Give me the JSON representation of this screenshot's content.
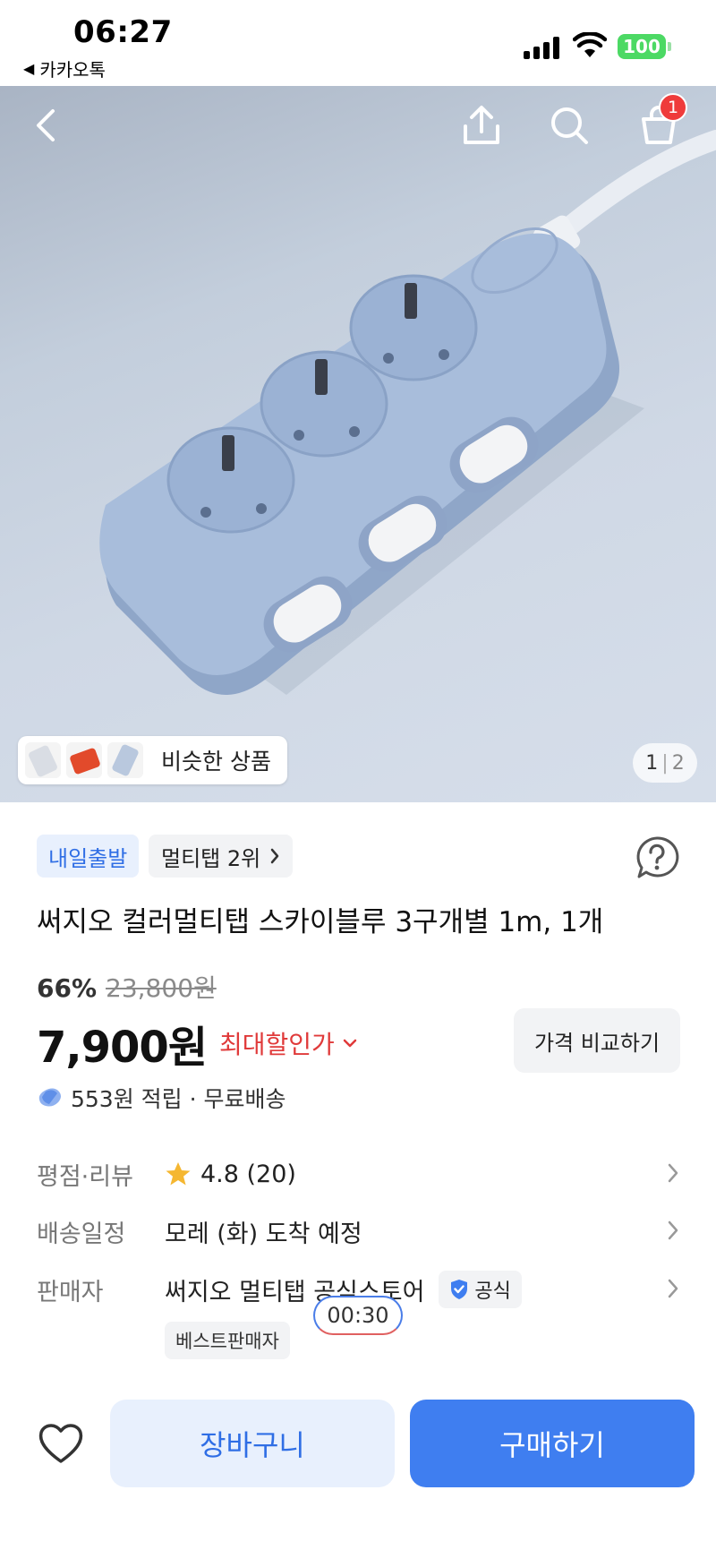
{
  "status_bar": {
    "time": "06:27",
    "back_app": "카카오톡",
    "battery": "100"
  },
  "hero": {
    "cart_count": "1",
    "similar_label": "비슷한 상품",
    "pager_current": "1",
    "pager_separator": "|",
    "pager_total": "2"
  },
  "product": {
    "tag_delivery": "내일출발",
    "tag_rank": "멀티탭 2위",
    "title": "써지오 컬러멀티탭 스카이블루 3구개별 1m, 1개",
    "discount_pct": "66%",
    "original_price": "23,800원",
    "price": "7,900원",
    "max_discount": "최대할인가",
    "compare_label": "가격 비교하기",
    "points": "553원 적립 · 무료배송"
  },
  "info": {
    "rating_label": "평점·리뷰",
    "rating_value": "4.8 (20)",
    "shipping_label": "배송일정",
    "shipping_value": "모레 (화) 도착 예정",
    "seller_label": "판매자",
    "seller_value": "써지오 멀티탭 공식스토어",
    "official_badge": "공식",
    "best_seller": "베스트판매자",
    "timer": "00:30"
  },
  "bottom_bar": {
    "cart_button": "장바구니",
    "buy_button": "구매하기"
  },
  "colors": {
    "accent_blue": "#3f7ef0",
    "discount_red": "#e03a3a",
    "badge_red": "#ef3b3b",
    "star": "#f5b731"
  }
}
